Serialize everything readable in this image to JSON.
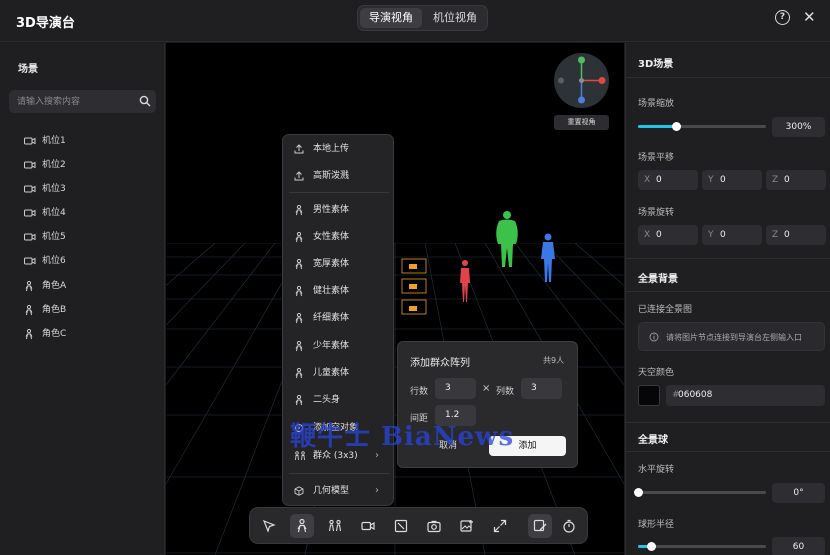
{
  "header": {
    "title": "3D导演台",
    "tabs": [
      "导演视角",
      "机位视角"
    ],
    "active_tab": 0,
    "help_icon": "help-circle-icon",
    "close_icon": "close-icon"
  },
  "left": {
    "title": "场景",
    "search_placeholder": "请输入搜索内容",
    "items": [
      {
        "label": "机位1",
        "icon": "camera-icon"
      },
      {
        "label": "机位2",
        "icon": "camera-icon"
      },
      {
        "label": "机位3",
        "icon": "camera-icon"
      },
      {
        "label": "机位4",
        "icon": "camera-icon"
      },
      {
        "label": "机位5",
        "icon": "camera-icon"
      },
      {
        "label": "机位6",
        "icon": "camera-icon"
      },
      {
        "label": "角色A",
        "icon": "person-icon"
      },
      {
        "label": "角色B",
        "icon": "person-icon"
      },
      {
        "label": "角色C",
        "icon": "person-icon"
      }
    ]
  },
  "viewport": {
    "reset_view": "重置视角"
  },
  "menu": {
    "upload_group": [
      {
        "label": "本地上传",
        "icon": "upload-icon"
      },
      {
        "label": "高斯泼溅",
        "icon": "upload-icon"
      }
    ],
    "body_group": [
      {
        "label": "男性素体",
        "icon": "person-icon"
      },
      {
        "label": "女性素体",
        "icon": "person-icon"
      },
      {
        "label": "宽厚素体",
        "icon": "person-icon"
      },
      {
        "label": "健壮素体",
        "icon": "person-icon"
      },
      {
        "label": "纤细素体",
        "icon": "person-icon"
      },
      {
        "label": "少年素体",
        "icon": "person-icon"
      },
      {
        "label": "儿童素体",
        "icon": "person-icon"
      },
      {
        "label": "二头身",
        "icon": "person-icon"
      },
      {
        "label": "添加空对象",
        "icon": "target-icon"
      },
      {
        "label": "群众 (3x3)",
        "icon": "crowd-icon"
      }
    ],
    "geometry": {
      "label": "几何模型",
      "icon": "cube-icon"
    }
  },
  "crowd_panel": {
    "title": "添加群众阵列",
    "total": "共9人",
    "rows_label": "行数",
    "rows": "3",
    "times": "×",
    "cols_label": "列数",
    "cols": "3",
    "spacing_label": "间距",
    "spacing": "1.2",
    "cancel": "取消",
    "add": "添加"
  },
  "toolbar": {
    "icons": [
      "select-icon",
      "person-icon",
      "crowd-icon",
      "camera-icon",
      "crop-icon",
      "photo-icon",
      "image-add-icon",
      "expand-icon",
      "brush-icon",
      "timer-icon"
    ],
    "active": [
      1,
      8
    ]
  },
  "right": {
    "title": "3D场景",
    "scale_label": "场景缩放",
    "scale_value": "300%",
    "scale_fraction": 0.3,
    "translate_label": "场景平移",
    "translate": {
      "x": "0",
      "y": "0",
      "z": "0"
    },
    "rotate_label": "场景旋转",
    "rotate": {
      "x": "0",
      "y": "0",
      "z": "0"
    },
    "axis_labels": {
      "x": "X",
      "y": "Y",
      "z": "Z"
    },
    "bg_title": "全景背景",
    "connected_label": "已连接全景图",
    "connect_hint": "请将图片节点连接到导演台左侧输入口",
    "sky_label": "天空颜色",
    "sky_hash": "#",
    "sky_color": "060608",
    "ball_title": "全景球",
    "hrot_label": "水平旋转",
    "hrot_value": "0°",
    "hrot_fraction": 0.0,
    "radius_label": "球形半径",
    "radius_value": "60",
    "radius_fraction": 0.1
  },
  "watermark": "鞭牛士 BiaNews",
  "colors": {
    "accent": "#22c4e8",
    "figure_green": "#3cc24a",
    "figure_red": "#e0444a",
    "figure_blue": "#3a78e6",
    "prop_orange": "#f0a020"
  }
}
